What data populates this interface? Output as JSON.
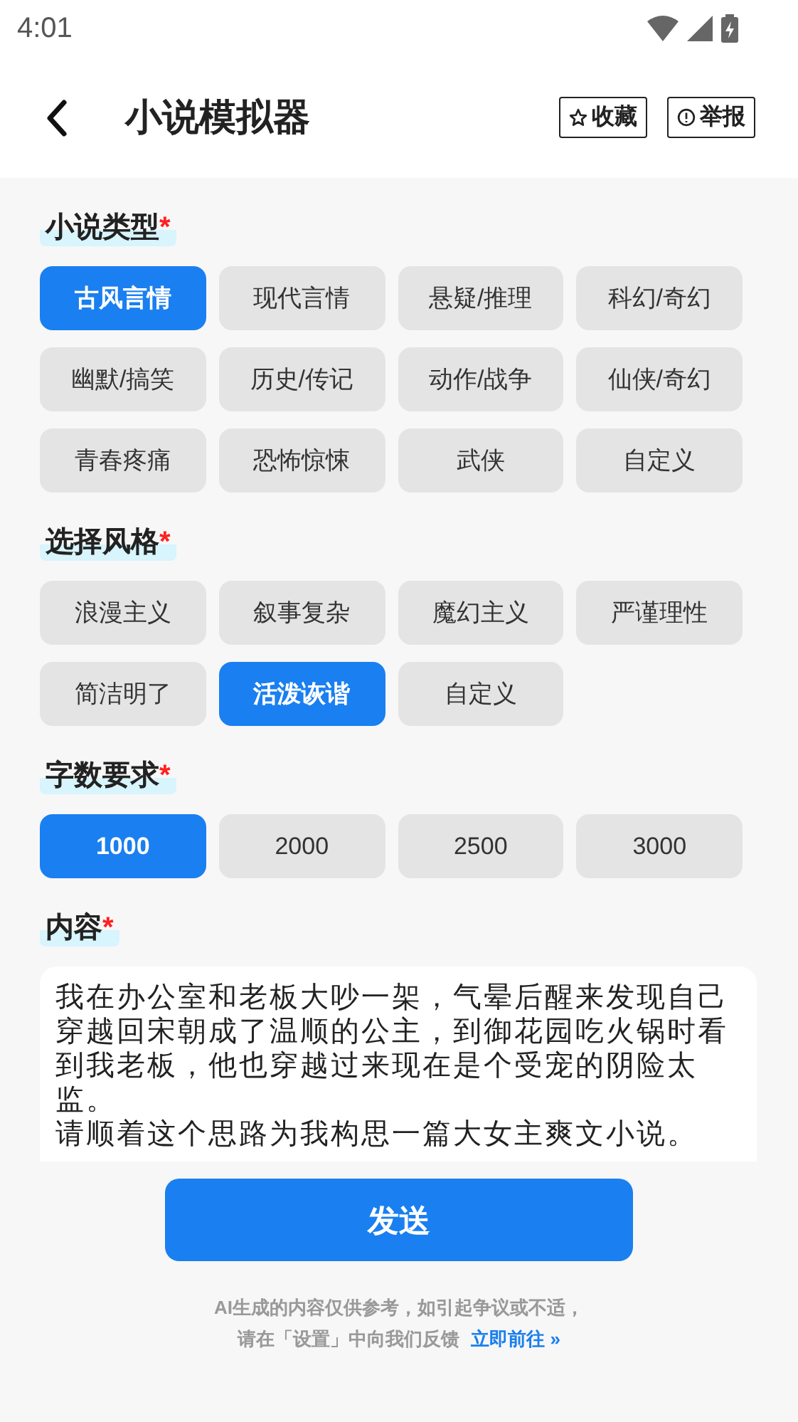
{
  "status_bar": {
    "time": "4:01"
  },
  "header": {
    "title": "小说模拟器",
    "actions": [
      {
        "kind": "star",
        "label": "收藏"
      },
      {
        "kind": "alert",
        "label": "举报"
      }
    ]
  },
  "sections": [
    {
      "kind": "options",
      "title": "小说类型",
      "required": true,
      "options": [
        {
          "label": "古风言情",
          "selected": true
        },
        {
          "label": "现代言情",
          "selected": false
        },
        {
          "label": "悬疑/推理",
          "selected": false
        },
        {
          "label": "科幻/奇幻",
          "selected": false
        },
        {
          "label": "幽默/搞笑",
          "selected": false
        },
        {
          "label": "历史/传记",
          "selected": false
        },
        {
          "label": "动作/战争",
          "selected": false
        },
        {
          "label": "仙侠/奇幻",
          "selected": false
        },
        {
          "label": "青春疼痛",
          "selected": false
        },
        {
          "label": "恐怖惊悚",
          "selected": false
        },
        {
          "label": "武侠",
          "selected": false
        },
        {
          "label": "自定义",
          "selected": false
        }
      ]
    },
    {
      "kind": "options",
      "title": "选择风格",
      "required": true,
      "options": [
        {
          "label": "浪漫主义",
          "selected": false
        },
        {
          "label": "叙事复杂",
          "selected": false
        },
        {
          "label": "魔幻主义",
          "selected": false
        },
        {
          "label": "严谨理性",
          "selected": false
        },
        {
          "label": "简洁明了",
          "selected": false
        },
        {
          "label": "活泼诙谐",
          "selected": true
        },
        {
          "label": "自定义",
          "selected": false
        }
      ]
    },
    {
      "kind": "options",
      "title": "字数要求",
      "required": true,
      "options": [
        {
          "label": "1000",
          "selected": true
        },
        {
          "label": "2000",
          "selected": false
        },
        {
          "label": "2500",
          "selected": false
        },
        {
          "label": "3000",
          "selected": false
        }
      ]
    },
    {
      "kind": "textarea",
      "title": "内容",
      "required": true,
      "paragraphs": [
        "我在办公室和老板大吵一架，气晕后醒来发现自己穿越回宋朝成了温顺的公主，到御花园吃火锅时看到我老板，他也穿越过来现在是个受宠的阴险太监。",
        "请顺着这个思路为我构思一篇大女主爽文小说。"
      ]
    }
  ],
  "required_mark": "*",
  "send_button": "发送",
  "footer": {
    "line1": "AI生成的内容仅供参考，如引起争议或不适，",
    "line2": "请在「设置」中向我们反馈",
    "link": "立即前往 »"
  }
}
